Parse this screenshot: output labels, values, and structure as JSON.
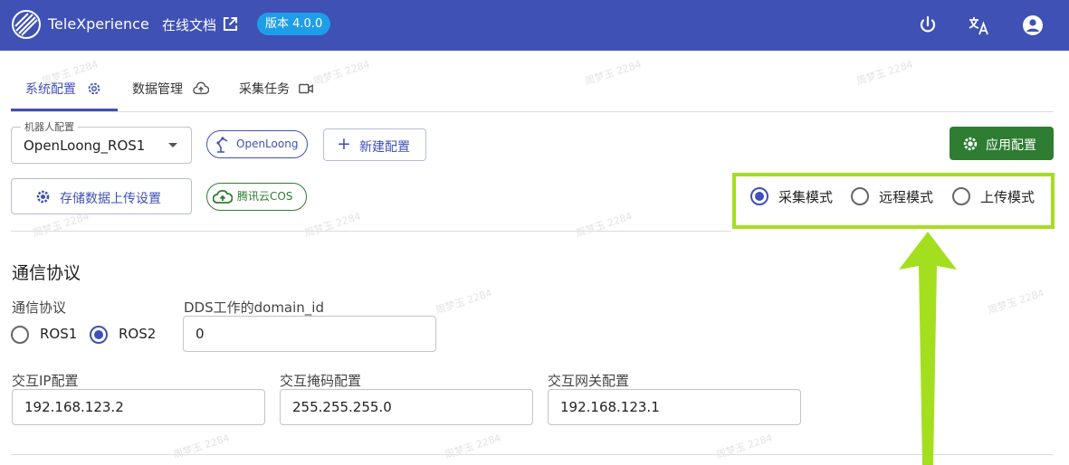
{
  "header": {
    "brand": "TeleXperience",
    "docs_link": "在线文档",
    "version": "版本 4.0.0",
    "bg_color": "#3f51b5"
  },
  "tabs": [
    {
      "label": "系统配置",
      "icon": "gear-icon",
      "active": true
    },
    {
      "label": "数据管理",
      "icon": "cloud-upload-icon",
      "active": false
    },
    {
      "label": "采集任务",
      "icon": "video-camera-icon",
      "active": false
    }
  ],
  "robot_config": {
    "label": "机器人配置",
    "value": "OpenLoong_ROS1"
  },
  "chips": {
    "robot": "OpenLoong",
    "cloud": "腾讯云COS"
  },
  "buttons": {
    "new_config": "新建配置",
    "apply_config": "应用配置",
    "storage_upload": "存储数据上传设置"
  },
  "modes": {
    "options": [
      "采集模式",
      "远程模式",
      "上传模式"
    ],
    "selected": "采集模式"
  },
  "protocol": {
    "section_title": "通信协议",
    "protocol_label": "通信协议",
    "options": [
      "ROS1",
      "ROS2"
    ],
    "selected": "ROS2",
    "domain_label": "DDS工作的domain_id",
    "domain_value": "0"
  },
  "network": {
    "ip_label": "交互IP配置",
    "ip_value": "192.168.123.2",
    "mask_label": "交互掩码配置",
    "mask_value": "255.255.255.0",
    "gateway_label": "交互网关配置",
    "gateway_value": "192.168.123.1"
  },
  "watermark": "周梦玉 2284",
  "colors": {
    "primary": "#3f51b5",
    "success": "#2e7d32",
    "highlight": "#a4df1f",
    "version_badge": "#1e9ee8"
  }
}
